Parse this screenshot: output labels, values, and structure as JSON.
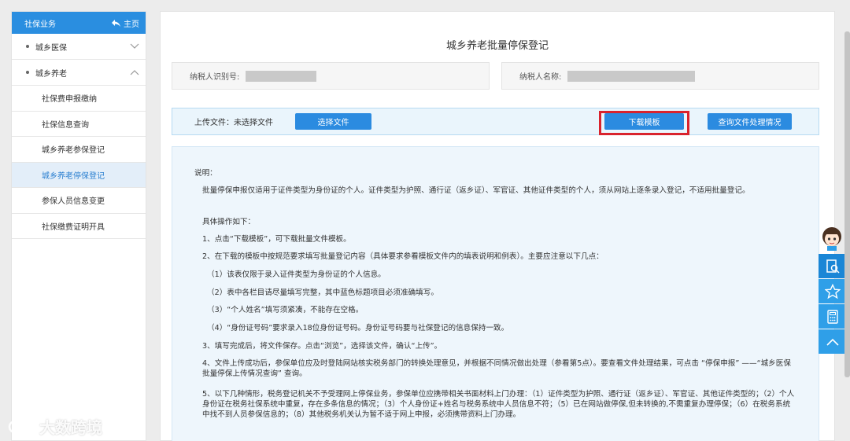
{
  "sidebar": {
    "header": "社保业务",
    "home": "主页",
    "groups": [
      {
        "label": "城乡医保"
      },
      {
        "label": "城乡养老"
      }
    ],
    "items": [
      {
        "label": "社保费申报缴纳"
      },
      {
        "label": "社保信息查询"
      },
      {
        "label": "城乡养老参保登记"
      },
      {
        "label": "城乡养老停保登记"
      },
      {
        "label": "参保人员信息变更"
      },
      {
        "label": "社保缴费证明开具"
      }
    ]
  },
  "page": {
    "title": "城乡养老批量停保登记",
    "taxpayer_id_label": "纳税人识别号:",
    "taxpayer_name_label": "纳税人名称:"
  },
  "upload": {
    "label": "上传文件：未选择文件",
    "choose_btn": "选择文件",
    "download_btn": "下载模板",
    "query_btn": "查询文件处理情况"
  },
  "description": {
    "lines": [
      "说明：",
      "批量停保申报仅适用于证件类型为身份证的个人。证件类型为护照、通行证（返乡证）、军官证、其他证件类型的个人，须从网站上逐条录入登记，不适用批量登记。",
      "具体操作如下：",
      "1、点击“下载模板”，可下载批量文件模板。",
      "2、在下载的模板中按规范要求填写批量登记内容（具体要求参看模板文件内的填表说明和例表）。主要应注意以下几点：",
      "（1）该表仅限于录入证件类型为身份证的个人信息。",
      "（2）表中各栏目请尽量填写完整，其中蓝色标题项目必须准确填写。",
      "（3）“个人姓名”填写须紧凑，不能存在空格。",
      "（4）“身份证号码”要求录入18位身份证号码。身份证号码要与社保登记的信息保持一致。",
      "3、填写完成后，将文件保存。点击“浏览”，选择该文件，确认“上传”。",
      "4、文件上传成功后，参保单位应及时登陆网站核实税务部门的转换处理意见，并根据不同情况做出处理（参看第5点）。要查看文件处理结果，可点击 “停保申报” ——“城乡医保批量停保上传情况查询” 查询。",
      "5、以下几种情形，税务登记机关不予受理网上停保业务，参保单位应携带相关书面材料上门办理：（1）证件类型为护照、通行证（返乡证）、军官证、其他证件类型的；（2）个人身份证在税务社保系统中重复，存在多条信息的情况；（3）个人身份证+姓名与税务系统中人员信息不符；（5）已在网站做停保,但未转换的,不需重复办理停保；（6）在税务系统中找不到人员参保信息的；（8）其他税务机关认为暂不适于网上申报，必须携带资料上门办理。"
    ]
  },
  "watermark": "大数跨境",
  "colors": {
    "primary": "#2a8ee0",
    "highlight_frame": "#d9232d",
    "active_bg": "#e3eef9"
  }
}
